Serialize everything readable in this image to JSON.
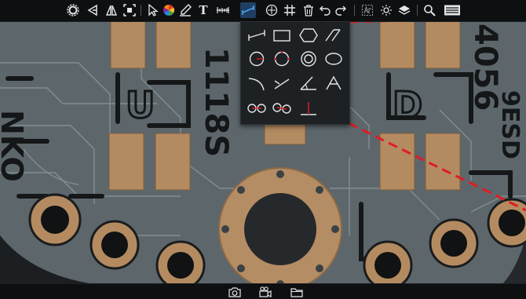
{
  "colors": {
    "pcb_background": "#5a6468",
    "solder_mask": "#4f595d",
    "copper_pad": "#b58d64",
    "trace": "#7f8c93",
    "silkscreen": "#161819",
    "measure_line": "#e01c24",
    "toolbar_bg": "#0e0f10",
    "toolbar_icon": "#e4e6e8",
    "menu_bg": "#1e2124",
    "active_tool": "#4aa3e6"
  },
  "toolbar": {
    "items": [
      {
        "name": "settings",
        "icon": "gear-icon"
      },
      {
        "name": "flip-horizontal",
        "icon": "flip-horizontal-icon"
      },
      {
        "name": "flip-vertical",
        "icon": "flip-vertical-icon"
      },
      {
        "name": "auto-focus",
        "icon": "focus-frame-icon"
      },
      {
        "name": "select",
        "icon": "cursor-icon"
      },
      {
        "name": "color",
        "icon": "color-wheel-icon"
      },
      {
        "name": "pen",
        "icon": "pen-icon"
      },
      {
        "name": "text",
        "icon": "text-icon"
      },
      {
        "name": "ruler",
        "icon": "ruler-icon"
      },
      {
        "name": "measure",
        "icon": "measure-icon",
        "active": true
      },
      {
        "name": "crosshair",
        "icon": "crosshair-icon"
      },
      {
        "name": "grid",
        "icon": "grid-icon"
      },
      {
        "name": "delete",
        "icon": "trash-icon"
      },
      {
        "name": "undo",
        "icon": "undo-icon"
      },
      {
        "name": "redo",
        "icon": "redo-icon"
      },
      {
        "name": "auto-exposure",
        "icon": "auto-exposure-icon"
      },
      {
        "name": "brightness",
        "icon": "sun-icon"
      },
      {
        "name": "layers",
        "icon": "layers-icon"
      },
      {
        "name": "zoom",
        "icon": "magnifier-icon"
      },
      {
        "name": "keyboard",
        "icon": "keyboard-icon"
      }
    ],
    "text_tool_glyph": "T"
  },
  "measure_menu": {
    "items": [
      {
        "name": "line-length",
        "icon": "line-length-icon"
      },
      {
        "name": "rectangle",
        "icon": "rectangle-icon"
      },
      {
        "name": "polygon",
        "icon": "hexagon-icon"
      },
      {
        "name": "parallel-lines",
        "icon": "parallel-lines-icon"
      },
      {
        "name": "circle-center-radius",
        "icon": "circle-radius-icon"
      },
      {
        "name": "circle-three-point",
        "icon": "circle-three-point-icon"
      },
      {
        "name": "concentric-circles",
        "icon": "concentric-circles-icon"
      },
      {
        "name": "ellipse",
        "icon": "ellipse-icon"
      },
      {
        "name": "arc",
        "icon": "arc-icon"
      },
      {
        "name": "point-to-line",
        "icon": "point-line-icon"
      },
      {
        "name": "angle",
        "icon": "angle-icon"
      },
      {
        "name": "four-point-angle",
        "icon": "four-point-angle-icon"
      },
      {
        "name": "circle-to-circle",
        "icon": "circle-distance-icon"
      },
      {
        "name": "circle-to-circle-offset",
        "icon": "circle-distance-offset-icon"
      },
      {
        "name": "perpendicular",
        "icon": "perpendicular-icon"
      }
    ]
  },
  "bottom_bar": {
    "items": [
      {
        "name": "snapshot",
        "icon": "camera-icon"
      },
      {
        "name": "record",
        "icon": "video-camera-icon"
      },
      {
        "name": "browse",
        "icon": "folder-icon"
      }
    ]
  },
  "silkscreen": {
    "label_a": "1118S",
    "label_b": "4056",
    "label_c": "9ESD",
    "label_d": "NKO",
    "label_e": "U",
    "label_f": "D"
  }
}
